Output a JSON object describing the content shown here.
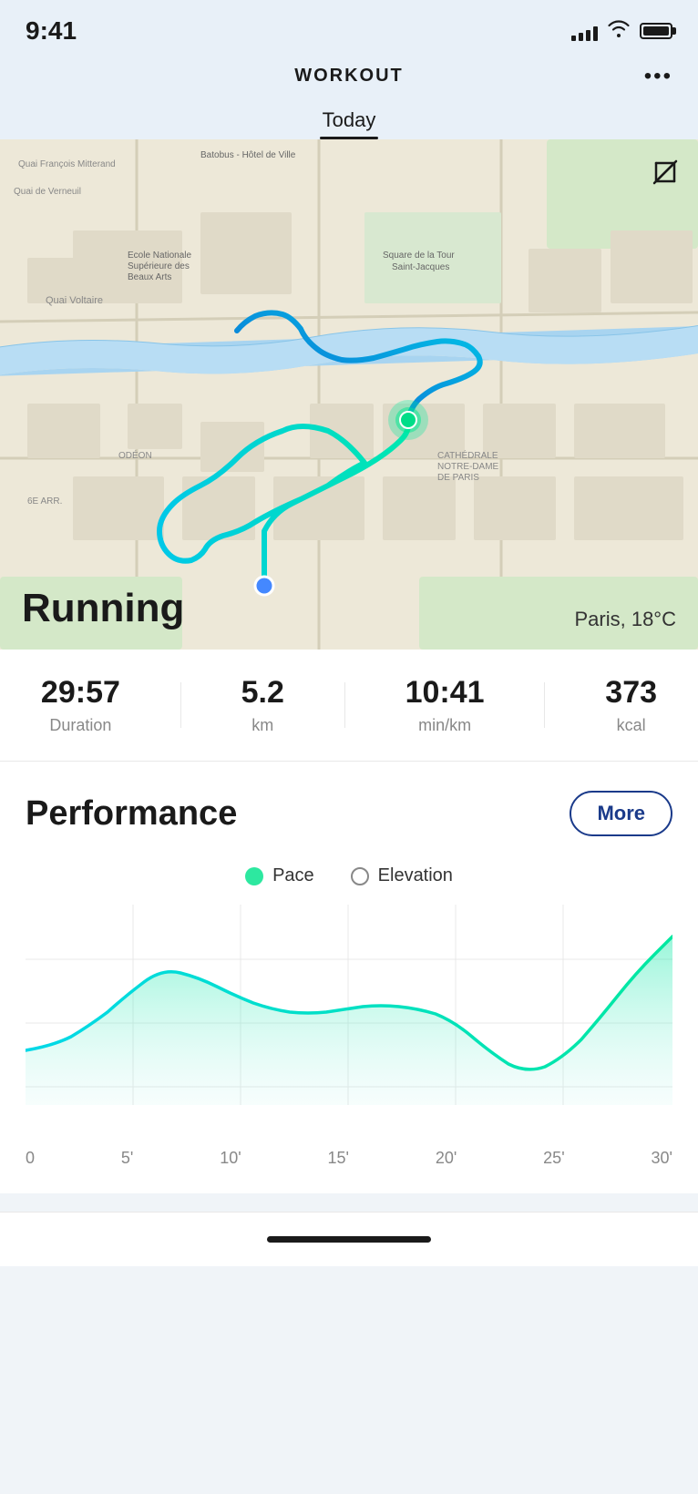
{
  "statusBar": {
    "time": "9:41",
    "signal": [
      4,
      6,
      9,
      12,
      14
    ],
    "battery": 100
  },
  "header": {
    "title": "WORKOUT",
    "menuLabel": "•••"
  },
  "tabs": [
    {
      "label": "Today",
      "active": true
    }
  ],
  "map": {
    "activityLabel": "Running",
    "location": "Paris, 18°C",
    "expandIcon": "expand-icon"
  },
  "stats": [
    {
      "value": "29:57",
      "label": "Duration"
    },
    {
      "value": "5.2",
      "label": "km"
    },
    {
      "value": "10:41",
      "label": "min/km"
    },
    {
      "value": "373",
      "label": "kcal"
    }
  ],
  "performance": {
    "title": "Performance",
    "moreLabel": "More",
    "legend": [
      {
        "label": "Pace",
        "type": "filled"
      },
      {
        "label": "Elevation",
        "type": "empty"
      }
    ],
    "chartXLabels": [
      "0",
      "5'",
      "10'",
      "15'",
      "20'",
      "25'",
      "30'"
    ]
  }
}
